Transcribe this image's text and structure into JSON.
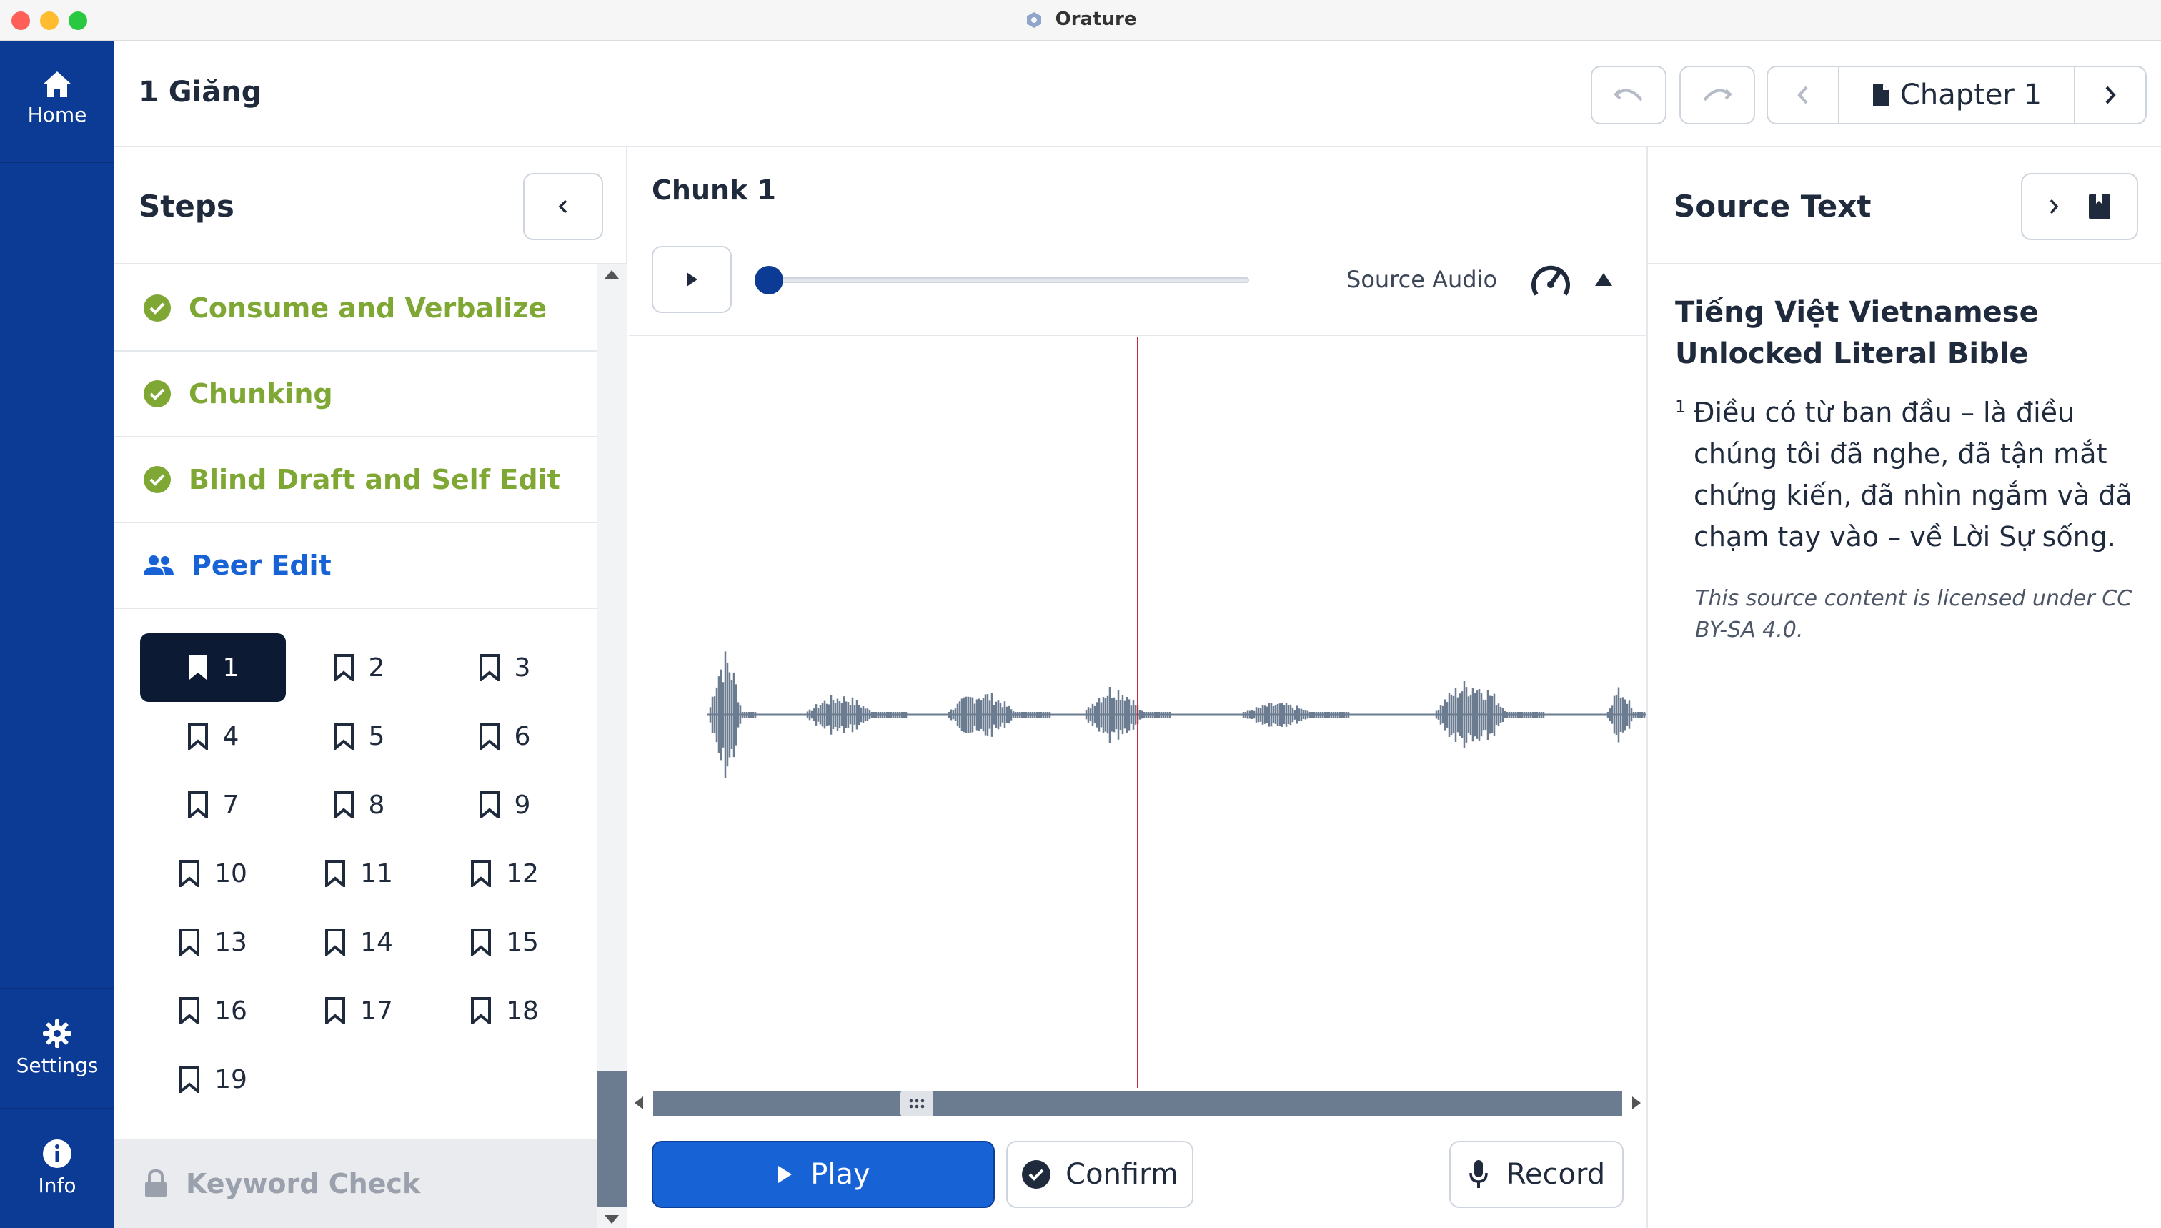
{
  "window": {
    "title": "Orature"
  },
  "nav": {
    "home": "Home",
    "settings": "Settings",
    "info": "Info"
  },
  "header": {
    "book_title": "1 Giăng",
    "chapter_label": "Chapter 1"
  },
  "steps": {
    "title": "Steps",
    "items": [
      {
        "label": "Consume and Verbalize",
        "status": "done"
      },
      {
        "label": "Chunking",
        "status": "done"
      },
      {
        "label": "Blind Draft and Self Edit",
        "status": "done"
      },
      {
        "label": "Peer Edit",
        "status": "active"
      },
      {
        "label": "Keyword Check",
        "status": "locked"
      }
    ],
    "chunks": [
      "1",
      "2",
      "3",
      "4",
      "5",
      "6",
      "7",
      "8",
      "9",
      "10",
      "11",
      "12",
      "13",
      "14",
      "15",
      "16",
      "17",
      "18",
      "19"
    ],
    "selected_chunk": "1"
  },
  "center": {
    "chunk_title": "Chunk 1",
    "source_audio_label": "Source Audio",
    "play_label": "Play",
    "confirm_label": "Confirm",
    "record_label": "Record"
  },
  "source": {
    "title": "Source Text",
    "bible_name": "Tiếng Việt Vietnamese Unlocked Literal Bible",
    "verse_number": "1",
    "verse_text": "Điều có từ ban đầu – là điều chúng tôi đã nghe, đã tận mắt chứng kiến, đã nhìn ngắm và đã chạm tay vào – về Lời Sự sống.",
    "license": "This source content is licensed under CC BY-SA 4.0."
  },
  "colors": {
    "nav": "#0b3b94",
    "done": "#7fa733",
    "active": "#1763d6",
    "waveform": "#6b7b90",
    "playhead": "#c9283c"
  }
}
